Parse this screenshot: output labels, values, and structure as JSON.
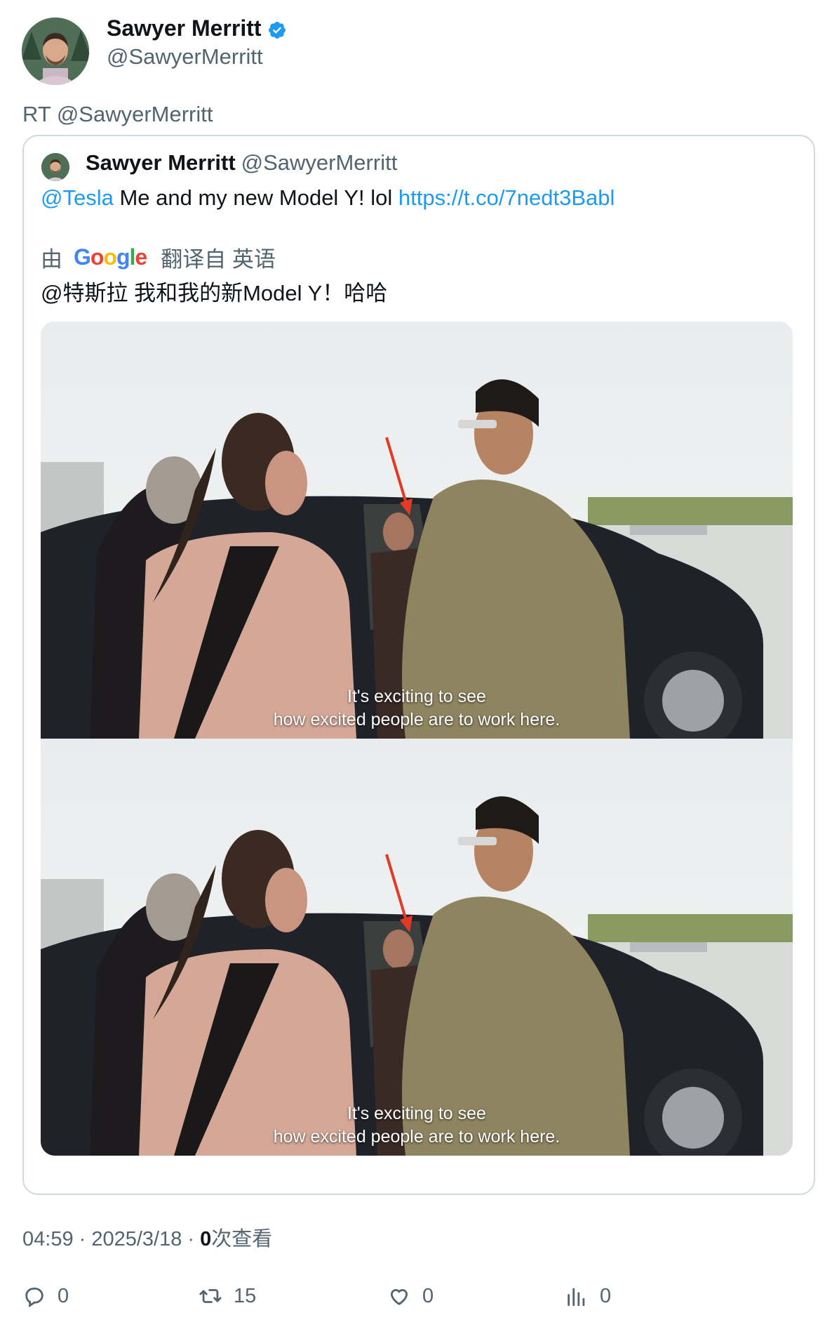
{
  "author": {
    "name": "Sawyer Merritt",
    "handle": "@SawyerMerritt",
    "verified_icon": "verified-badge-icon"
  },
  "retweet_line": "RT @SawyerMerritt",
  "quoted": {
    "name": "Sawyer Merritt",
    "handle": "@SawyerMerritt",
    "mention": "@Tesla",
    "text": " Me and my new Model Y! lol ",
    "link": "https://t.co/7nedt3Babl",
    "translation": {
      "prefix": "由",
      "provider": "Google",
      "suffix": "翻译自 英语",
      "text": "@特斯拉 我和我的新Model Y！哈哈"
    },
    "media": {
      "caption_line1": "It's exciting to see",
      "caption_line2": "how excited people are to work here."
    }
  },
  "meta": {
    "time": "04:59",
    "sep1": " · ",
    "date": "2025/3/18",
    "sep2": " · ",
    "views_count": "0",
    "views_label": "次查看"
  },
  "actions": {
    "replies": "0",
    "retweets": "15",
    "likes": "0",
    "views": "0"
  },
  "colors": {
    "link": "#1d9bf0",
    "secondary_text": "#536471",
    "border": "#cfd9de",
    "verified": "#1d9bf0"
  }
}
